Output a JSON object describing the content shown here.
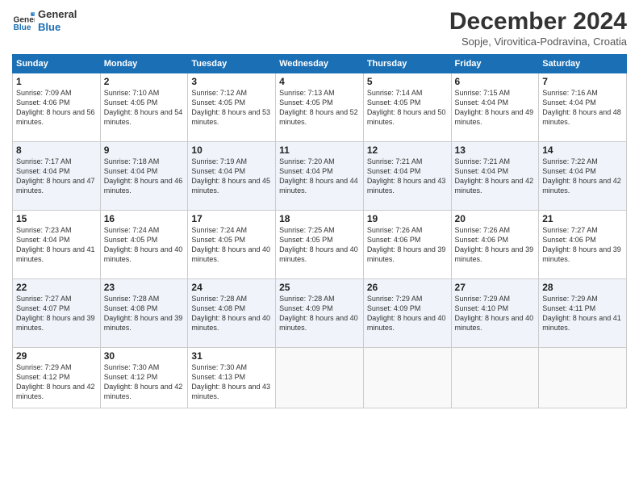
{
  "header": {
    "logo_line1": "General",
    "logo_line2": "Blue",
    "month_title": "December 2024",
    "location": "Sopje, Virovitica-Podravina, Croatia"
  },
  "weekdays": [
    "Sunday",
    "Monday",
    "Tuesday",
    "Wednesday",
    "Thursday",
    "Friday",
    "Saturday"
  ],
  "weeks": [
    [
      {
        "day": "1",
        "sunrise": "Sunrise: 7:09 AM",
        "sunset": "Sunset: 4:06 PM",
        "daylight": "Daylight: 8 hours and 56 minutes."
      },
      {
        "day": "2",
        "sunrise": "Sunrise: 7:10 AM",
        "sunset": "Sunset: 4:05 PM",
        "daylight": "Daylight: 8 hours and 54 minutes."
      },
      {
        "day": "3",
        "sunrise": "Sunrise: 7:12 AM",
        "sunset": "Sunset: 4:05 PM",
        "daylight": "Daylight: 8 hours and 53 minutes."
      },
      {
        "day": "4",
        "sunrise": "Sunrise: 7:13 AM",
        "sunset": "Sunset: 4:05 PM",
        "daylight": "Daylight: 8 hours and 52 minutes."
      },
      {
        "day": "5",
        "sunrise": "Sunrise: 7:14 AM",
        "sunset": "Sunset: 4:05 PM",
        "daylight": "Daylight: 8 hours and 50 minutes."
      },
      {
        "day": "6",
        "sunrise": "Sunrise: 7:15 AM",
        "sunset": "Sunset: 4:04 PM",
        "daylight": "Daylight: 8 hours and 49 minutes."
      },
      {
        "day": "7",
        "sunrise": "Sunrise: 7:16 AM",
        "sunset": "Sunset: 4:04 PM",
        "daylight": "Daylight: 8 hours and 48 minutes."
      }
    ],
    [
      {
        "day": "8",
        "sunrise": "Sunrise: 7:17 AM",
        "sunset": "Sunset: 4:04 PM",
        "daylight": "Daylight: 8 hours and 47 minutes."
      },
      {
        "day": "9",
        "sunrise": "Sunrise: 7:18 AM",
        "sunset": "Sunset: 4:04 PM",
        "daylight": "Daylight: 8 hours and 46 minutes."
      },
      {
        "day": "10",
        "sunrise": "Sunrise: 7:19 AM",
        "sunset": "Sunset: 4:04 PM",
        "daylight": "Daylight: 8 hours and 45 minutes."
      },
      {
        "day": "11",
        "sunrise": "Sunrise: 7:20 AM",
        "sunset": "Sunset: 4:04 PM",
        "daylight": "Daylight: 8 hours and 44 minutes."
      },
      {
        "day": "12",
        "sunrise": "Sunrise: 7:21 AM",
        "sunset": "Sunset: 4:04 PM",
        "daylight": "Daylight: 8 hours and 43 minutes."
      },
      {
        "day": "13",
        "sunrise": "Sunrise: 7:21 AM",
        "sunset": "Sunset: 4:04 PM",
        "daylight": "Daylight: 8 hours and 42 minutes."
      },
      {
        "day": "14",
        "sunrise": "Sunrise: 7:22 AM",
        "sunset": "Sunset: 4:04 PM",
        "daylight": "Daylight: 8 hours and 42 minutes."
      }
    ],
    [
      {
        "day": "15",
        "sunrise": "Sunrise: 7:23 AM",
        "sunset": "Sunset: 4:04 PM",
        "daylight": "Daylight: 8 hours and 41 minutes."
      },
      {
        "day": "16",
        "sunrise": "Sunrise: 7:24 AM",
        "sunset": "Sunset: 4:05 PM",
        "daylight": "Daylight: 8 hours and 40 minutes."
      },
      {
        "day": "17",
        "sunrise": "Sunrise: 7:24 AM",
        "sunset": "Sunset: 4:05 PM",
        "daylight": "Daylight: 8 hours and 40 minutes."
      },
      {
        "day": "18",
        "sunrise": "Sunrise: 7:25 AM",
        "sunset": "Sunset: 4:05 PM",
        "daylight": "Daylight: 8 hours and 40 minutes."
      },
      {
        "day": "19",
        "sunrise": "Sunrise: 7:26 AM",
        "sunset": "Sunset: 4:06 PM",
        "daylight": "Daylight: 8 hours and 39 minutes."
      },
      {
        "day": "20",
        "sunrise": "Sunrise: 7:26 AM",
        "sunset": "Sunset: 4:06 PM",
        "daylight": "Daylight: 8 hours and 39 minutes."
      },
      {
        "day": "21",
        "sunrise": "Sunrise: 7:27 AM",
        "sunset": "Sunset: 4:06 PM",
        "daylight": "Daylight: 8 hours and 39 minutes."
      }
    ],
    [
      {
        "day": "22",
        "sunrise": "Sunrise: 7:27 AM",
        "sunset": "Sunset: 4:07 PM",
        "daylight": "Daylight: 8 hours and 39 minutes."
      },
      {
        "day": "23",
        "sunrise": "Sunrise: 7:28 AM",
        "sunset": "Sunset: 4:08 PM",
        "daylight": "Daylight: 8 hours and 39 minutes."
      },
      {
        "day": "24",
        "sunrise": "Sunrise: 7:28 AM",
        "sunset": "Sunset: 4:08 PM",
        "daylight": "Daylight: 8 hours and 40 minutes."
      },
      {
        "day": "25",
        "sunrise": "Sunrise: 7:28 AM",
        "sunset": "Sunset: 4:09 PM",
        "daylight": "Daylight: 8 hours and 40 minutes."
      },
      {
        "day": "26",
        "sunrise": "Sunrise: 7:29 AM",
        "sunset": "Sunset: 4:09 PM",
        "daylight": "Daylight: 8 hours and 40 minutes."
      },
      {
        "day": "27",
        "sunrise": "Sunrise: 7:29 AM",
        "sunset": "Sunset: 4:10 PM",
        "daylight": "Daylight: 8 hours and 40 minutes."
      },
      {
        "day": "28",
        "sunrise": "Sunrise: 7:29 AM",
        "sunset": "Sunset: 4:11 PM",
        "daylight": "Daylight: 8 hours and 41 minutes."
      }
    ],
    [
      {
        "day": "29",
        "sunrise": "Sunrise: 7:29 AM",
        "sunset": "Sunset: 4:12 PM",
        "daylight": "Daylight: 8 hours and 42 minutes."
      },
      {
        "day": "30",
        "sunrise": "Sunrise: 7:30 AM",
        "sunset": "Sunset: 4:12 PM",
        "daylight": "Daylight: 8 hours and 42 minutes."
      },
      {
        "day": "31",
        "sunrise": "Sunrise: 7:30 AM",
        "sunset": "Sunset: 4:13 PM",
        "daylight": "Daylight: 8 hours and 43 minutes."
      },
      null,
      null,
      null,
      null
    ]
  ]
}
